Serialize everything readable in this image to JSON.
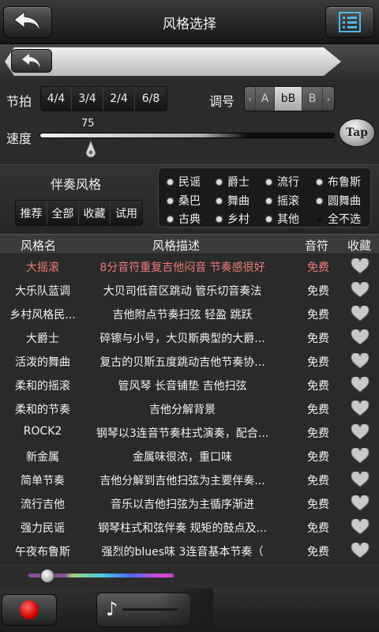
{
  "header": {
    "title": "风格选择",
    "back_icon": "back-arrow-icon",
    "menu_icon": "list-menu-icon"
  },
  "subbar": {
    "back_icon": "undo-arrow-icon"
  },
  "meter": {
    "label": "节拍",
    "options": [
      "4/4",
      "3/4",
      "2/4",
      "6/8"
    ]
  },
  "key": {
    "label": "调号",
    "options": [
      "A",
      "bB",
      "B"
    ],
    "selected": "bB"
  },
  "tempo": {
    "label": "速度",
    "value": "75",
    "tap_label": "Tap"
  },
  "accompaniment": {
    "label": "伴奏风格",
    "filters": [
      "推荐",
      "全部",
      "收藏",
      "试用"
    ],
    "genres": [
      "民谣",
      "爵士",
      "流行",
      "布鲁斯",
      "桑巴",
      "舞曲",
      "摇滚",
      "圆舞曲",
      "古典",
      "乡村",
      "其他",
      "全不选"
    ]
  },
  "table": {
    "headers": {
      "name": "风格名",
      "desc": "风格描述",
      "price": "音符",
      "fav": "收藏"
    },
    "rows": [
      {
        "name": "大摇滚",
        "desc": "8分音符重复吉他闷音 节奏感很好",
        "price": "免费",
        "highlight": true
      },
      {
        "name": "大乐队蓝调",
        "desc": "大贝司低音区跳动 管乐切音奏法",
        "price": "免费"
      },
      {
        "name": "乡村风格民...",
        "desc": "吉他附点节奏扫弦 轻盈 跳跃",
        "price": "免费"
      },
      {
        "name": "大爵士",
        "desc": "碎镲与小号，大贝斯典型的大爵...",
        "price": "免费"
      },
      {
        "name": "活泼的舞曲",
        "desc": "复古的贝斯五度跳动吉他节奏协...",
        "price": "免费"
      },
      {
        "name": "柔和的摇滚",
        "desc": "管风琴 长音铺垫 吉他扫弦",
        "price": "免费"
      },
      {
        "name": "柔和的节奏",
        "desc": "吉他分解背景",
        "price": "免费"
      },
      {
        "name": "ROCK2",
        "desc": "钢琴以3连音节奏柱式演奏，配合...",
        "price": "免费"
      },
      {
        "name": "新金属",
        "desc": "金属味很浓，重口味",
        "price": "免费"
      },
      {
        "name": "简单节奏",
        "desc": "吉他分解到吉他扫弦为主要伴奏...",
        "price": "免费"
      },
      {
        "name": "流行吉他",
        "desc": "音乐以吉他扫弦为主循序渐进",
        "price": "免费"
      },
      {
        "name": "强力民谣",
        "desc": "钢琴柱式和弦伴奏 规矩的鼓点及...",
        "price": "免费"
      },
      {
        "name": "午夜布鲁斯",
        "desc": "强烈的blues味 3连音基本节奏（",
        "price": "免费"
      }
    ]
  },
  "playback": {
    "progress": 0.13
  },
  "bottom": {
    "record_icon": "record-icon",
    "note_icon_glyph": "♪"
  }
}
